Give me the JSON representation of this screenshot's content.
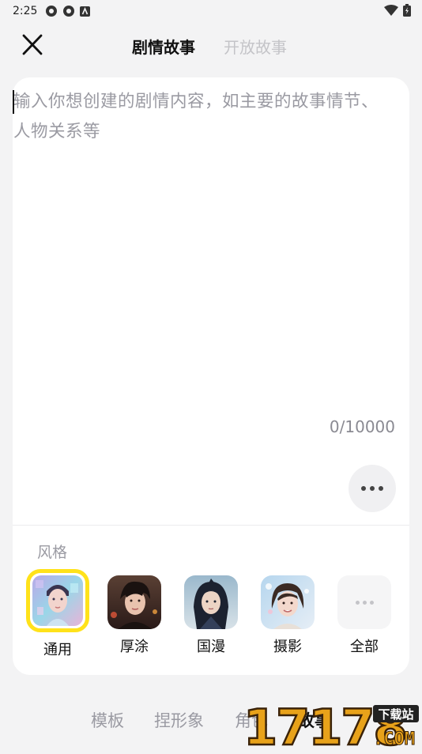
{
  "status_bar": {
    "time": "2:25"
  },
  "nav": {
    "tabs": [
      {
        "label": "剧情故事",
        "active": true
      },
      {
        "label": "开放故事",
        "active": false
      }
    ]
  },
  "editor": {
    "placeholder": "输入你想创建的剧情内容，如主要的故事情节、人物关系等",
    "counter": "0/10000"
  },
  "style_section": {
    "label": "风格",
    "items": [
      {
        "label": "通用",
        "selected": true
      },
      {
        "label": "厚涂",
        "selected": false
      },
      {
        "label": "国漫",
        "selected": false
      },
      {
        "label": "摄影",
        "selected": false
      },
      {
        "label": "全部",
        "selected": false
      }
    ]
  },
  "bottom_nav": {
    "items": [
      "模板",
      "捏形象",
      "角色",
      "故事"
    ]
  },
  "watermark": {
    "digits": "17178",
    "badge": "下载站",
    "domain": ".COM"
  },
  "colors": {
    "selected_border": "#ffe21a",
    "card": "#ffffff",
    "background": "#f3f3f4"
  }
}
